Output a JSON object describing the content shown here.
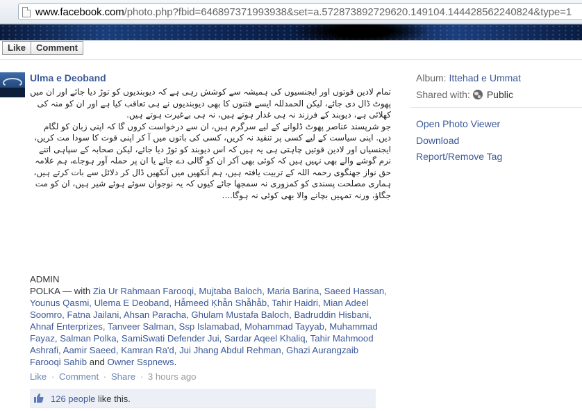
{
  "browser": {
    "url_host": "www.facebook.com",
    "url_rest": "/photo.php?fbid=646897371993938&set=a.572873892729620.149104.144428562240824&type=1"
  },
  "photo_actions": {
    "like_label": "Like",
    "comment_label": "Comment"
  },
  "post": {
    "author": "Ulma e Deoband",
    "paragraphs": [
      "تمام لادین قوتوں اور ایجنسیوں کی ہمیشہ سے کوشش رہی ہے کہ دیوبندیوں کو توڑ دیا جائے اور ان میں پھوٹ ڈال دی جائے، لیکن الحمدللہ ایسے فتنوں کا بھی دیوبندیوں نے ہی تعاقب کیا ہے اور ان کو منہ کی کھلائی ہے، دیوبند کے فرزند نہ ہی غدار ہوتے ہیں، نہ ہی بےغیرت ہوتے ہیں.",
      "جو شرپسند عناصر پھوٹ ڈلوانے کے لیے سرگرم ہیں، ان سے درخواست کروں گا کہ اپنی زبان کو لگام دیں. اپنی سیاست کے لیے کسی پر تنقید نہ کریں، کسی کی باتوں میں آ کر اپنی قوت کا سودا مت کریں، ایجنسیاں اور لادین قوتیں چاہتی ہی یہ ہیں کہ اس دیوبند کو توڑ دیا جائے، لیکن صحابہ کے سپاہی اتنے نرم گوشے والے بھی نہیں ہیں کہ کوئی بھی آکر ان کو گالی دے جائے یا ان پر حملہ آور ہوجاے، ہم علامہ حق نواز جھنگوی رحمہ اللہ کے تربیت یافتہ ہیں، ہم آنکھیں میں آنکھیں ڈال کر دلائل سے بات کرتے ہیں، ہماری مصلحت پسندی کو کمزوری نہ سمجھا جائے کیوں کہ یہ نوجوان سوئے ہوئے شیر ہیں، ان کو مت جگاؤ، ورنہ تمہیں بچانے والا بھی کوئی نہ ہوگا...."
    ],
    "signature_admin": "ADMIN",
    "signature_name": "POLKA",
    "with_label": " — with ",
    "tagged": "Zia Ur Rahmaan Farooqi, Mujtaba Baloch, Maria Barina, Saeed Hassan, Younus Qasmi, Ulema E Deoband, Hẫmeed Ķhẫn Shẫhẫb, Tahir Haidri, Mian Adeel Soomro, Fatna Jailani, Ahsan Paracha, Ghulam Mustafa Baloch, Badruddin Hisbani, Ahnaf Enterprizes, Tanveer Salman, Ssp Islamabad, Mohammad Tayyab, Muhammad Fayaz, Salman Polka, SamiSwati Defender Jui, Sardar Aqeel Khaliq, Tahir Mahmood Ashrafi, Aamir Saeed, Kamran Ra'd, Jui Jhang Abdul Rehman, Ghazi Aurangzaib Farooqi Sahib",
    "and_label": " and ",
    "others_label": "Owner Sspnews",
    "end_punct": "."
  },
  "post_actions": {
    "like": "Like",
    "comment": "Comment",
    "share": "Share",
    "sep": "·",
    "time": "3 hours ago"
  },
  "likes": {
    "count_text": "126 people",
    "suffix": " like this."
  },
  "sidebar": {
    "album_label": "Album:",
    "album_value": "Ittehad e Ummat",
    "shared_label": "Shared with:",
    "shared_value": "Public",
    "links": [
      "Open Photo Viewer",
      "Download",
      "Report/Remove Tag"
    ]
  },
  "colors": {
    "link": "#3b5998",
    "likes_bg": "#eceff5"
  }
}
